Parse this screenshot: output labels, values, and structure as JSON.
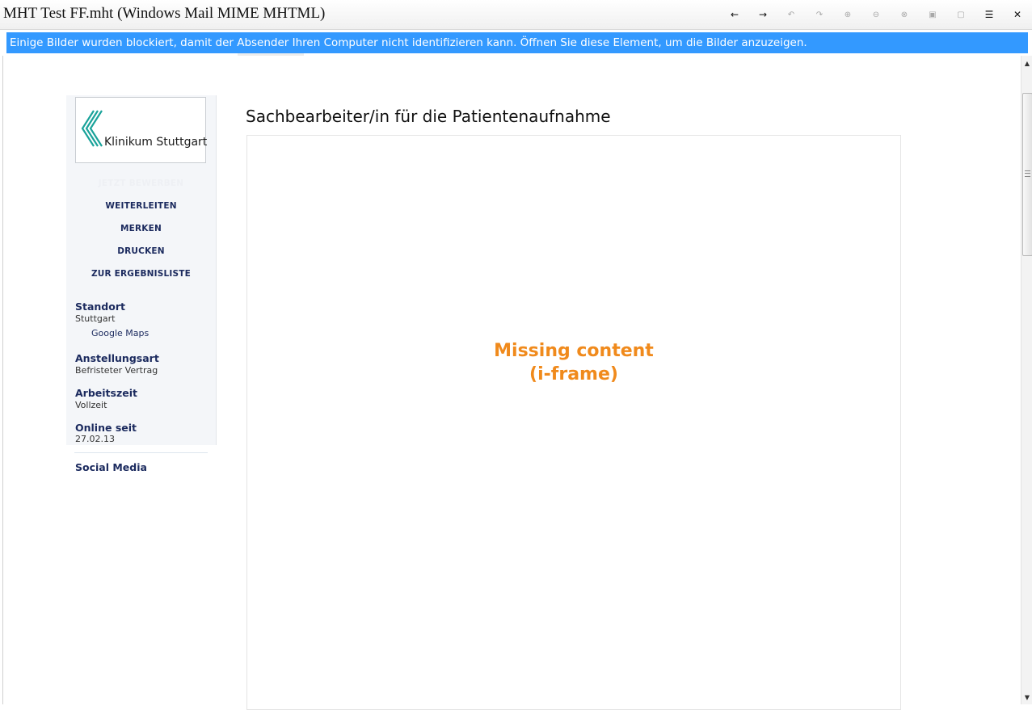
{
  "window": {
    "title": "MHT Test FF.mht (Windows Mail MIME MHTML)"
  },
  "toolbar": {
    "buttons": [
      {
        "name": "back-arrow-icon",
        "glyph": "←",
        "enabled": true
      },
      {
        "name": "forward-arrow-icon",
        "glyph": "→",
        "enabled": true
      },
      {
        "name": "undo-icon",
        "glyph": "↶",
        "enabled": false
      },
      {
        "name": "redo-icon",
        "glyph": "↷",
        "enabled": false
      },
      {
        "name": "zoom-in-icon",
        "glyph": "⊕",
        "enabled": false
      },
      {
        "name": "zoom-out-icon",
        "glyph": "⊖",
        "enabled": false
      },
      {
        "name": "zoom-reset-icon",
        "glyph": "⊗",
        "enabled": false
      },
      {
        "name": "fit-page-icon",
        "glyph": "▣",
        "enabled": false
      },
      {
        "name": "fullscreen-icon",
        "glyph": "▢",
        "enabled": false
      },
      {
        "name": "menu-icon",
        "glyph": "☰",
        "enabled": true
      },
      {
        "name": "close-icon",
        "glyph": "✕",
        "enabled": true
      }
    ]
  },
  "infobar": {
    "message": "Einige Bilder wurden blockiert, damit der Absender Ihren Computer nicht identifizieren kann. Öffnen Sie diese Element, um die Bilder anzuzeigen."
  },
  "sidebar": {
    "logo_text": "Klinikum Stuttgart",
    "links": {
      "apply": "JETZT BEWERBEN",
      "forward": "WEITERLEITEN",
      "remember": "MERKEN",
      "print": "DRUCKEN",
      "results": "ZUR ERGEBNISLISTE"
    },
    "location": {
      "label": "Standort",
      "value": "Stuttgart",
      "maps_link": "Google Maps"
    },
    "employment": {
      "label": "Anstellungsart",
      "value": "Befristeter Vertrag"
    },
    "worktime": {
      "label": "Arbeitszeit",
      "value": "Vollzeit"
    },
    "online": {
      "label": "Online seit",
      "value": "27.02.13"
    },
    "social": {
      "label": "Social Media"
    }
  },
  "main": {
    "job_title": "Sachbearbeiter/in für die Patientenaufnahme",
    "missing_line1": "Missing content",
    "missing_line2": "(i-frame)"
  },
  "colors": {
    "infobar": "#3399ff",
    "navy": "#1b2a5e",
    "missing": "#f08a1c",
    "logo_teal": "#1aa39a"
  }
}
